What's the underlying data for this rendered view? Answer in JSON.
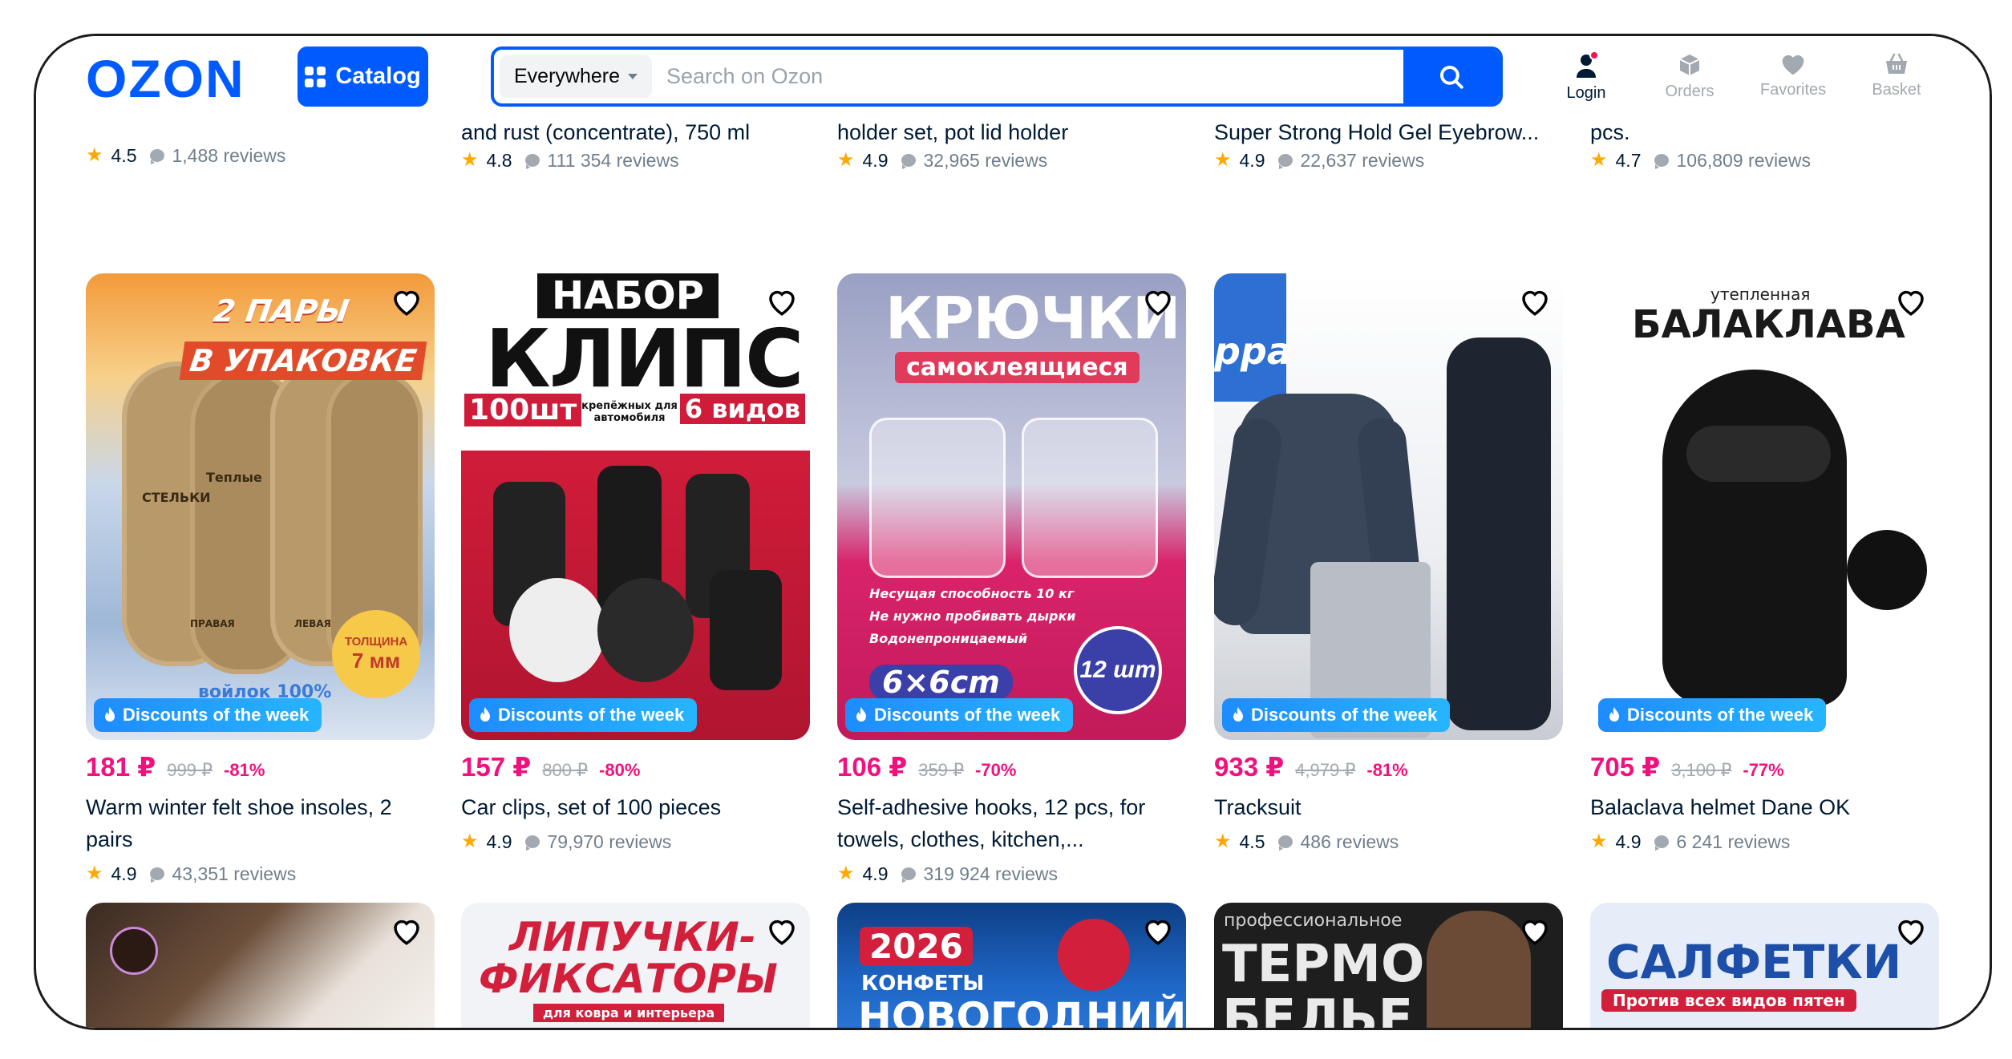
{
  "header": {
    "logo": "OZON",
    "catalog_label": "Catalog",
    "search_scope": "Everywhere",
    "search_placeholder": "Search on Ozon",
    "nav": [
      {
        "label": "Login"
      },
      {
        "label": "Orders"
      },
      {
        "label": "Favorites"
      },
      {
        "label": "Basket"
      }
    ]
  },
  "top_row": [
    {
      "title": "",
      "rating": "4.5",
      "reviews": "1,488 reviews"
    },
    {
      "title": "and rust (concentrate), 750 ml",
      "rating": "4.8",
      "reviews": "111 354 reviews"
    },
    {
      "title": "holder set, pot lid holder",
      "rating": "4.9",
      "reviews": "32,965 reviews"
    },
    {
      "title": "Super Strong Hold Gel Eyebrow...",
      "rating": "4.9",
      "reviews": "22,637 reviews"
    },
    {
      "title": "pcs.",
      "rating": "4.7",
      "reviews": "106,809 reviews"
    }
  ],
  "products": [
    {
      "badge": "Discounts of the week",
      "price": "181 ₽",
      "old_price": "999 ₽",
      "discount": "-81%",
      "title": "Warm winter felt shoe insoles, 2 pairs",
      "rating": "4.9",
      "reviews": "43,351 reviews",
      "img_text": [
        "2 ПАРЫ",
        "В УПАКОВКЕ",
        "Теплые",
        "СТЕЛЬКИ",
        "ПРАВАЯ",
        "ЛЕВАЯ",
        "войлок 100%",
        "ТОЛЩИНА",
        "7 мм"
      ]
    },
    {
      "badge": "Discounts of the week",
      "price": "157 ₽",
      "old_price": "800 ₽",
      "discount": "-80%",
      "title": "Car clips, set of 100 pieces",
      "rating": "4.9",
      "reviews": "79,970 reviews",
      "img_text": [
        "НАБОР",
        "КЛИПС",
        "100шт",
        "крепёжных для автомобиля",
        "6 видов"
      ]
    },
    {
      "badge": "Discounts of the week",
      "price": "106 ₽",
      "old_price": "359 ₽",
      "discount": "-70%",
      "title": "Self-adhesive hooks, 12 pcs, for towels, clothes, kitchen,...",
      "rating": "4.9",
      "reviews": "319 924 reviews",
      "img_text": [
        "КРЮЧКИ",
        "самоклеящиеся",
        "Несущая способность 10 кг",
        "Не нужно пробивать дырки",
        "Водонепроницаемый",
        "6×6cm",
        "12 шт"
      ]
    },
    {
      "badge": "Discounts of the week",
      "price": "933 ₽",
      "old_price": "4,979 ₽",
      "discount": "-81%",
      "title": "Tracksuit",
      "rating": "4.5",
      "reviews": "486 reviews",
      "img_text": [
        "ppa"
      ]
    },
    {
      "badge": "Discounts of the week",
      "price": "705 ₽",
      "old_price": "3,100 ₽",
      "discount": "-77%",
      "title": "Balaclava helmet Dane OK",
      "rating": "4.9",
      "reviews": "6 241 reviews",
      "img_text": [
        "утепленная",
        "БАЛАКЛАВА"
      ]
    }
  ],
  "bottom_row": [
    {
      "img_text": []
    },
    {
      "img_text": [
        "ЛИПУЧКИ-",
        "ФИКСАТОРЫ",
        "для ковра и интерьера"
      ]
    },
    {
      "img_text": [
        "2026",
        "КОНФЕТЫ",
        "НОВОГОДНИЙ"
      ]
    },
    {
      "img_text": [
        "профессиональное",
        "ТЕРМО",
        "БЕЛЬЕ"
      ]
    },
    {
      "img_text": [
        "САЛФЕТКИ",
        "Против всех видов пятен"
      ]
    }
  ],
  "colors": {
    "brand": "#005bff",
    "price": "#f1117e",
    "star": "#ffa800",
    "muted": "#a2a9b0"
  }
}
